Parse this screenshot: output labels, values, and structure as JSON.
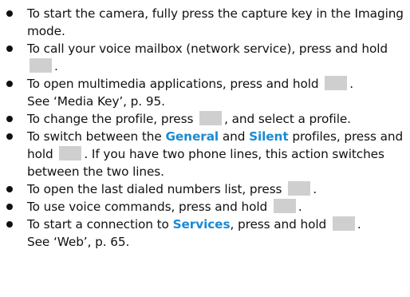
{
  "items": [
    {
      "a": "To start the camera, fully press the capture key in the Imaging mode."
    },
    {
      "a": "To call your voice mailbox (network service), press and hold",
      "b": "."
    },
    {
      "a": "To open multimedia applications, press and hold",
      "b": ".",
      "c": "See ‘Media Key’, p. 95."
    },
    {
      "a": "To change the profile, press",
      "b": ", and select a profile."
    },
    {
      "a": "To switch between the",
      "kw1": "General",
      "mid": "and",
      "kw2": "Silent",
      "b": "profiles, press and hold",
      "c": ". If you have two phone lines, this action switches between the two lines."
    },
    {
      "a": "To open the last dialed numbers list, press",
      "b": "."
    },
    {
      "a": "To use voice commands, press and hold",
      "b": "."
    },
    {
      "a": "To start a connection to",
      "kw1": "Services",
      "b": ", press and hold",
      "c": ".",
      "d": "See ‘Web’, p. 65."
    }
  ],
  "colors": {
    "text": "#111111",
    "keyword": "#1a8ad4",
    "key_placeholder": "#cfcfcf"
  }
}
